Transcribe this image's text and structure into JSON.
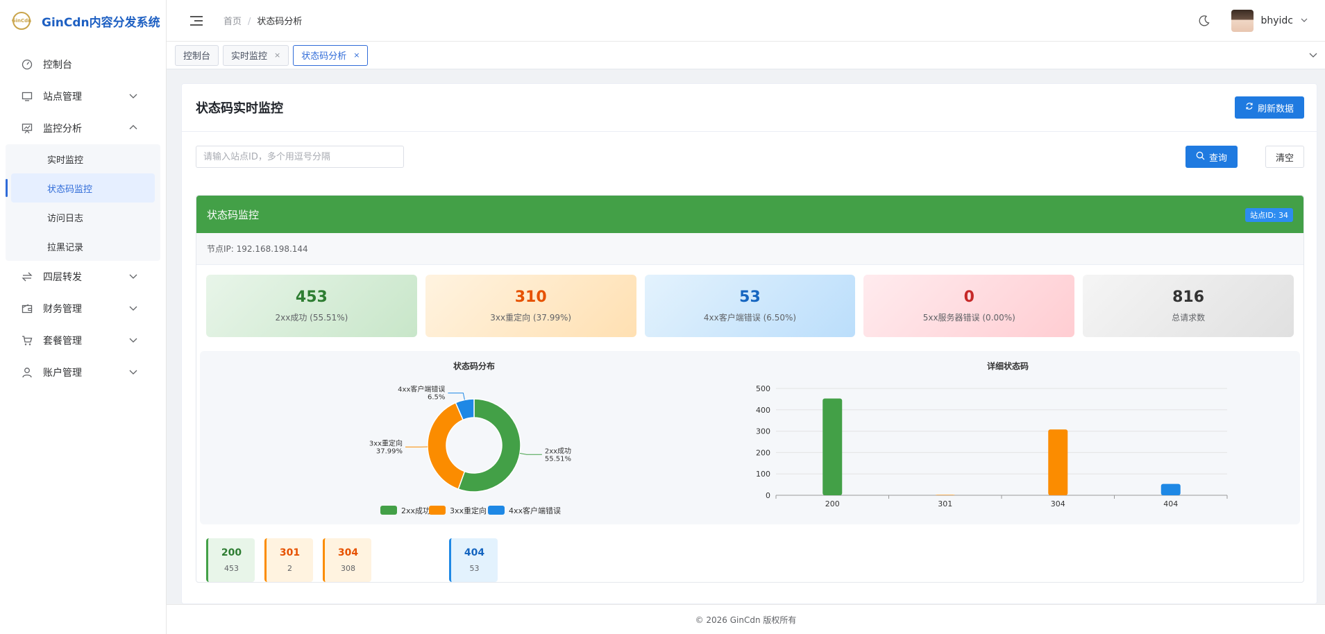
{
  "app": {
    "title": "GinCdn内容分发系统",
    "logo_text": "GinCdn"
  },
  "sidebar": {
    "items": [
      {
        "label": "控制台",
        "icon": "dashboard-icon"
      },
      {
        "label": "站点管理",
        "icon": "monitor-icon"
      },
      {
        "label": "监控分析",
        "icon": "chart-icon",
        "expanded": true
      },
      {
        "label": "四层转发",
        "icon": "forward-icon"
      },
      {
        "label": "财务管理",
        "icon": "wallet-icon"
      },
      {
        "label": "套餐管理",
        "icon": "cart-icon"
      },
      {
        "label": "账户管理",
        "icon": "user-icon"
      }
    ],
    "sub_items": [
      {
        "label": "实时监控"
      },
      {
        "label": "状态码监控",
        "active": true
      },
      {
        "label": "访问日志"
      },
      {
        "label": "拉黑记录"
      }
    ]
  },
  "header": {
    "breadcrumb_home": "首页",
    "breadcrumb_sep": "/",
    "breadcrumb_current": "状态码分析",
    "username": "bhyidc"
  },
  "tabs": [
    {
      "label": "控制台"
    },
    {
      "label": "实时监控",
      "close": "×"
    },
    {
      "label": "状态码分析",
      "close": "×",
      "active": true
    }
  ],
  "main": {
    "title": "状态码实时监控",
    "refresh_label": "刷新数据",
    "search_placeholder": "请输入站点ID，多个用逗号分隔",
    "query_label": "查询",
    "clear_label": "清空",
    "panel_title": "状态码监控",
    "site_badge": "站点ID: 34",
    "node_ip": "节点IP: 192.168.198.144",
    "stats": [
      {
        "num": "453",
        "label": "2xx成功 (55.51%)"
      },
      {
        "num": "310",
        "label": "3xx重定向 (37.99%)"
      },
      {
        "num": "53",
        "label": "4xx客户端错误 (6.50%)"
      },
      {
        "num": "0",
        "label": "5xx服务器错误 (0.00%)"
      },
      {
        "num": "816",
        "label": "总请求数"
      }
    ],
    "code_cards": [
      {
        "code": "200",
        "count": "453"
      },
      {
        "code": "301",
        "count": "2"
      },
      {
        "code": "304",
        "count": "308"
      },
      {
        "code": "404",
        "count": "53"
      }
    ]
  },
  "colors": {
    "green": "#43a047",
    "orange": "#fb8c00",
    "blue": "#1e88e5",
    "primary": "#1f7ae0"
  },
  "chart_data": [
    {
      "type": "pie",
      "title": "状态码分布",
      "categories": [
        "2xx成功",
        "3xx重定向",
        "4xx客户端错误"
      ],
      "values": [
        55.51,
        37.99,
        6.5
      ],
      "value_labels": [
        "55.51%",
        "37.99%",
        "6.5%"
      ],
      "colors": [
        "#43a047",
        "#fb8c00",
        "#1e88e5"
      ],
      "legend": "bottom"
    },
    {
      "type": "bar",
      "title": "详细状态码",
      "categories": [
        "200",
        "301",
        "304",
        "404"
      ],
      "values": [
        453,
        2,
        308,
        53
      ],
      "colors": [
        "#43a047",
        "#fb8c00",
        "#fb8c00",
        "#1e88e5"
      ],
      "yticks": [
        0,
        100,
        200,
        300,
        400,
        500
      ],
      "ylim": [
        0,
        500
      ],
      "grid": true
    }
  ],
  "footer": {
    "text": "© 2026 GinCdn 版权所有"
  }
}
